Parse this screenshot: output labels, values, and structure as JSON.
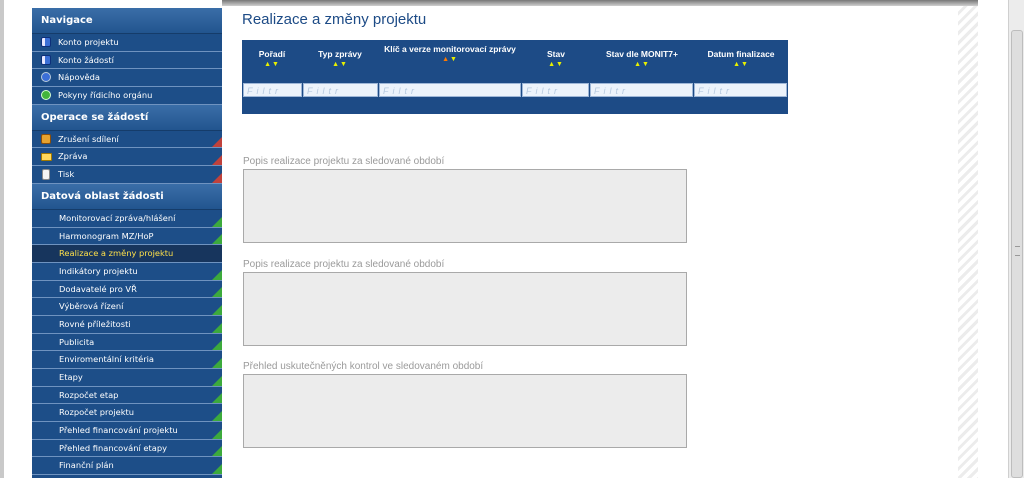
{
  "sidebar": {
    "navigace": {
      "title": "Navigace",
      "items": [
        {
          "label": "Konto projektu",
          "icon": "book-icon"
        },
        {
          "label": "Konto žádostí",
          "icon": "book-icon"
        },
        {
          "label": "Nápověda",
          "icon": "help-icon"
        },
        {
          "label": "Pokyny řídicího orgánu",
          "icon": "settings-icon"
        }
      ]
    },
    "operace": {
      "title": "Operace se žádostí",
      "items": [
        {
          "label": "Zrušení sdílení",
          "icon": "cancel-share-icon"
        },
        {
          "label": "Zpráva",
          "icon": "mail-icon"
        },
        {
          "label": "Tisk",
          "icon": "document-icon"
        }
      ]
    },
    "datova": {
      "title": "Datová oblast žádosti",
      "items": [
        {
          "label": "Monitorovací zpráva/hlášení"
        },
        {
          "label": "Harmonogram MZ/HoP"
        },
        {
          "label": "Realizace a změny projektu",
          "active": true
        },
        {
          "label": "Indikátory projektu"
        },
        {
          "label": "Dodavatelé pro VŘ"
        },
        {
          "label": "Výběrová řízení"
        },
        {
          "label": "Rovné příležitosti"
        },
        {
          "label": "Publicita"
        },
        {
          "label": "Enviromentální kritéria"
        },
        {
          "label": "Etapy"
        },
        {
          "label": "Rozpočet etap"
        },
        {
          "label": "Rozpočet projektu"
        },
        {
          "label": "Přehled financování projektu"
        },
        {
          "label": "Přehled financování etapy"
        },
        {
          "label": "Finanční plán"
        }
      ]
    }
  },
  "main": {
    "title": "Realizace a změny projektu",
    "grid": {
      "columns": [
        "Pořadí",
        "Typ zprávy",
        "Klíč a verze monitorovací zprávy",
        "Stav",
        "Stav dle MONIT7+",
        "Datum finalizace"
      ],
      "filter_placeholder": "Filtr"
    },
    "fields": [
      {
        "label": "Popis realizace projektu za sledované období",
        "value": ""
      },
      {
        "label": "Popis realizace projektu za sledované období",
        "value": ""
      },
      {
        "label": "Přehled uskutečněných kontrol ve sledovaném období",
        "value": ""
      }
    ]
  }
}
